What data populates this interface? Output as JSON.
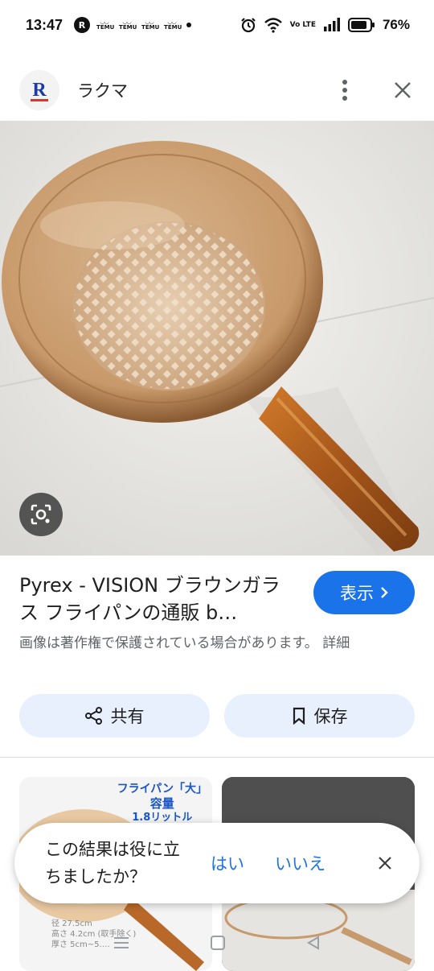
{
  "status_bar": {
    "time": "13:47",
    "notif_badge": "R",
    "temu_labels": [
      "TEMU",
      "TEMU",
      "TEMU",
      "TEMU"
    ],
    "network_label": "Vo LTE",
    "battery_percent": "76%"
  },
  "header": {
    "site_logo_letter": "R",
    "site_name": "ラクマ"
  },
  "result": {
    "title": "Pyrex - VISION ブラウンガラス フライパンの通販 b…",
    "view_button_label": "表示",
    "copyright_notice": "画像は著作権で保護されている場合があります。 詳細"
  },
  "actions": {
    "share_label": "共有",
    "save_label": "保存"
  },
  "related": {
    "item1_line1": "フライパン「大」",
    "item1_line2": "容量",
    "item1_line3": "1.8リットル",
    "item1_spec1": "径 27.5cm",
    "item1_spec2": "高さ 4.2cm (取手除く)",
    "item1_spec3": "厚さ 5cm~5.…"
  },
  "feedback": {
    "question": "この結果は役に立ちましたか？",
    "yes_label": "はい",
    "no_label": "いいえ"
  },
  "colors": {
    "accent": "#1a73e8",
    "chip_bg": "#e8f0fe",
    "amber_glass": "#a8642a"
  }
}
